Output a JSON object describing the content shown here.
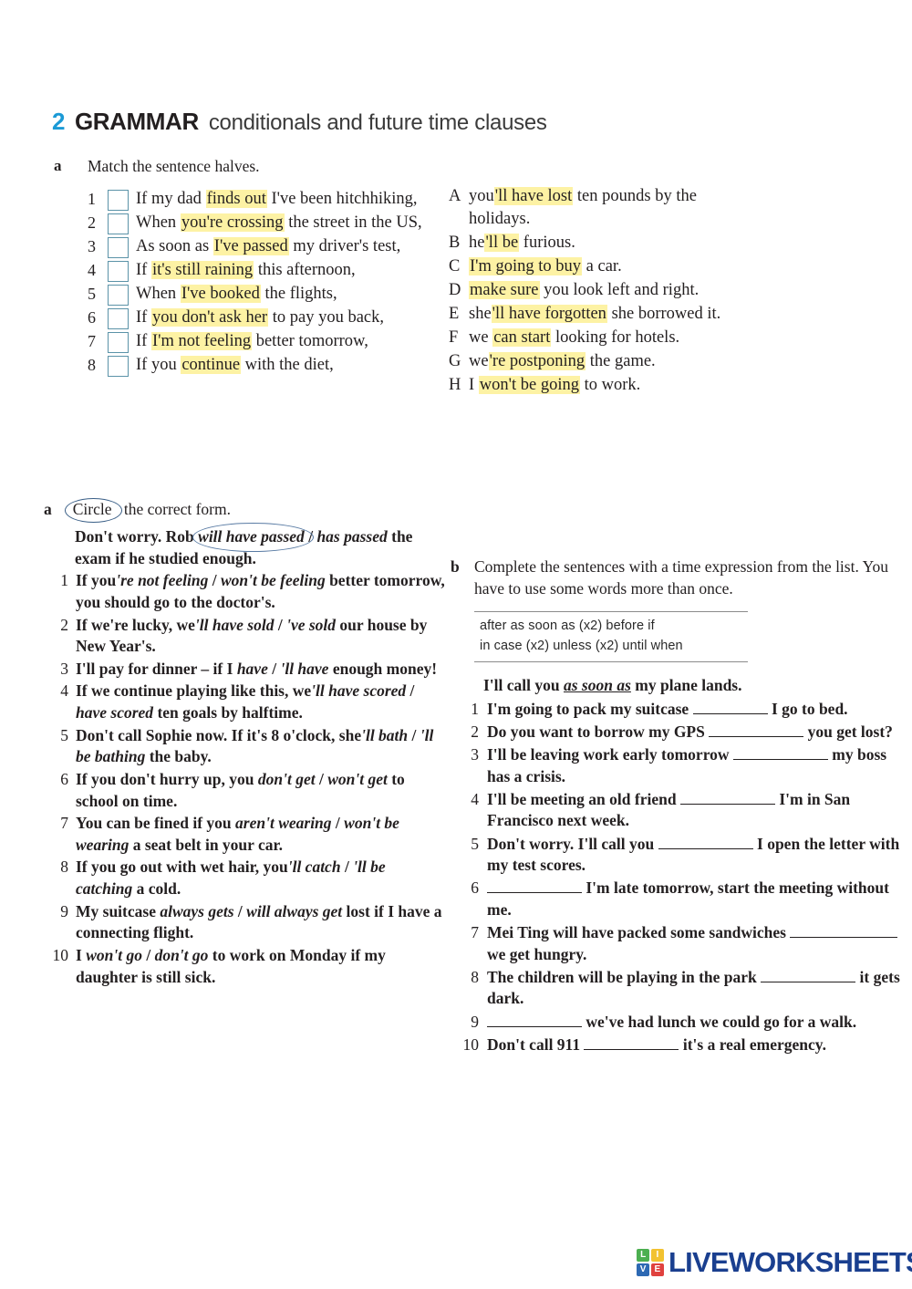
{
  "heading": {
    "number": "2",
    "title": "GRAMMAR",
    "subtitle": "conditionals and future time clauses",
    "accent_color": "#1b9ad6"
  },
  "colors": {
    "highlight": "#fdf2a4",
    "checkbox_border": "#5b93a8",
    "ink_annotation": "#4a6f9b",
    "logo_blue": "#1a3f8f"
  },
  "exercise_match": {
    "label": "a",
    "rubric": "Match the sentence halves.",
    "left_items": [
      {
        "num": "1",
        "pre": "If my dad ",
        "hl": "finds out",
        "post": " I've been hitchhiking,"
      },
      {
        "num": "2",
        "pre": "When ",
        "hl": "you're crossing",
        "post": " the street in the US,"
      },
      {
        "num": "3",
        "pre": "As soon as ",
        "hl": "I've passed",
        "post": " my driver's test,"
      },
      {
        "num": "4",
        "pre": "If ",
        "hl": "it's still raining",
        "post": " this afternoon,"
      },
      {
        "num": "5",
        "pre": "When ",
        "hl": "I've booked",
        "post": " the flights,"
      },
      {
        "num": "6",
        "pre": "If ",
        "hl": "you don't ask her",
        "post": " to pay you back,"
      },
      {
        "num": "7",
        "pre": "If ",
        "hl": "I'm not feeling",
        "post": " better tomorrow,"
      },
      {
        "num": "8",
        "pre": "If you ",
        "hl": "continue",
        "post": " with the diet,"
      }
    ],
    "right_items": [
      {
        "letter": "A",
        "pre": "you",
        "hl": "'ll have lost",
        "post": " ten pounds by the holidays."
      },
      {
        "letter": "B",
        "pre": "he",
        "hl": "'ll be",
        "post": " furious."
      },
      {
        "letter": "C",
        "pre": "",
        "hl": "I'm going to buy",
        "post": " a car."
      },
      {
        "letter": "D",
        "pre": "",
        "hl": "make sure",
        "post": " you look left and right."
      },
      {
        "letter": "E",
        "pre": "she",
        "hl": "'ll have forgotten",
        "post": " she borrowed it."
      },
      {
        "letter": "F",
        "pre": "we ",
        "hl": "can start",
        "post": " looking for hotels."
      },
      {
        "letter": "G",
        "pre": "we",
        "hl": "'re postponing",
        "post": " the game."
      },
      {
        "letter": "H",
        "pre": "I ",
        "hl": "won't be going",
        "post": " to work."
      }
    ]
  },
  "exercise_circle": {
    "label": "a",
    "rubric_circled": "Circle",
    "rubric_rest": "the correct form.",
    "example": {
      "pre": "Don't worry. Rob ",
      "option_a": "will have passed",
      "separator": " / ",
      "option_b": "has passed",
      "post": " the exam if he studied enough.",
      "circled_option": "will have passed"
    },
    "items": [
      {
        "num": "1",
        "pre": "If you",
        "opt_a": "'re not feeling",
        "sep": " / ",
        "opt_b": "won't be feeling",
        "post": " better tomorrow, you should go to the doctor's."
      },
      {
        "num": "2",
        "pre": "If we're lucky, we",
        "opt_a": "'ll have sold",
        "sep": " / ",
        "opt_b": "'ve sold",
        "post": " our house by New Year's."
      },
      {
        "num": "3",
        "pre": "I'll pay for dinner – if I ",
        "opt_a": "have",
        "sep": " / ",
        "opt_b": "'ll have",
        "post": " enough money!"
      },
      {
        "num": "4",
        "pre": "If we continue playing like this, we",
        "opt_a": "'ll have scored",
        "sep": " / ",
        "opt_b": "have scored",
        "post": " ten goals by halftime."
      },
      {
        "num": "5",
        "pre": "Don't call Sophie now. If it's 8 o'clock, she",
        "opt_a": "'ll bath",
        "sep": " / ",
        "opt_b": "'ll be bathing",
        "post": " the baby."
      },
      {
        "num": "6",
        "pre": "If you don't hurry up, you ",
        "opt_a": "don't get",
        "sep": " / ",
        "opt_b": "won't get",
        "post": " to school on time."
      },
      {
        "num": "7",
        "pre": "You can be fined if you ",
        "opt_a": "aren't wearing",
        "sep": " / ",
        "opt_b": "won't be wearing",
        "post": " a seat belt in your car."
      },
      {
        "num": "8",
        "pre": "If you go out with wet hair, you",
        "opt_a": "'ll catch",
        "sep": " / ",
        "opt_b": "'ll be catching",
        "post": " a cold."
      },
      {
        "num": "9",
        "pre": "My suitcase ",
        "opt_a": "always gets",
        "sep": " / ",
        "opt_b": "will always get",
        "post": " lost if I have a connecting flight."
      },
      {
        "num": "10",
        "pre": "I ",
        "opt_a": "won't go",
        "sep": " / ",
        "opt_b": "don't go",
        "post": " to work on Monday if my daughter is still sick."
      }
    ]
  },
  "exercise_gapfill": {
    "label": "b",
    "rubric": "Complete the sentences with a time expression from the list. You have to use some words more than once.",
    "wordbank_line1": "after    as soon as (x2)   before   if",
    "wordbank_line2": "in case (x2)   unless (x2)   until   when",
    "example": {
      "pre": "I'll call you ",
      "answer": "as soon as",
      "post": " my plane lands."
    },
    "items": [
      {
        "num": "1",
        "pre": "I'm going to pack my suitcase ",
        "blank": "bl-sm",
        "post": " I go to bed."
      },
      {
        "num": "2",
        "pre": "Do you want to borrow my GPS ",
        "blank": "bl-md",
        "post": " you get lost?"
      },
      {
        "num": "3",
        "pre": "I'll be leaving work early tomorrow ",
        "blank": "bl-md",
        "post": " my boss has a crisis."
      },
      {
        "num": "4",
        "pre": "I'll be meeting an old friend ",
        "blank": "bl-md",
        "post": " I'm in San Francisco next week."
      },
      {
        "num": "5",
        "pre": "Don't worry. I'll call you ",
        "blank": "bl-md",
        "post": " I open the letter with my test scores."
      },
      {
        "num": "6",
        "pre": "",
        "blank": "bl-md",
        "post": " I'm late tomorrow, start the meeting without me."
      },
      {
        "num": "7",
        "pre": "Mei Ting will have packed some sandwiches ",
        "blank": "bl-lg",
        "post": " we get hungry."
      },
      {
        "num": "8",
        "pre": "The children will be playing in the park ",
        "blank": "bl-md",
        "post": " it gets dark."
      },
      {
        "num": "9",
        "pre": "",
        "blank": "bl-md",
        "post": " we've had lunch we could go for a walk."
      },
      {
        "num": "10",
        "pre": "Don't call 911 ",
        "blank": "bl-md",
        "post": " it's a real emergency."
      }
    ]
  },
  "footer": {
    "logo_letters": [
      "L",
      "I",
      "V",
      "E"
    ],
    "wordmark": "LIVEWORKSHEETS"
  }
}
